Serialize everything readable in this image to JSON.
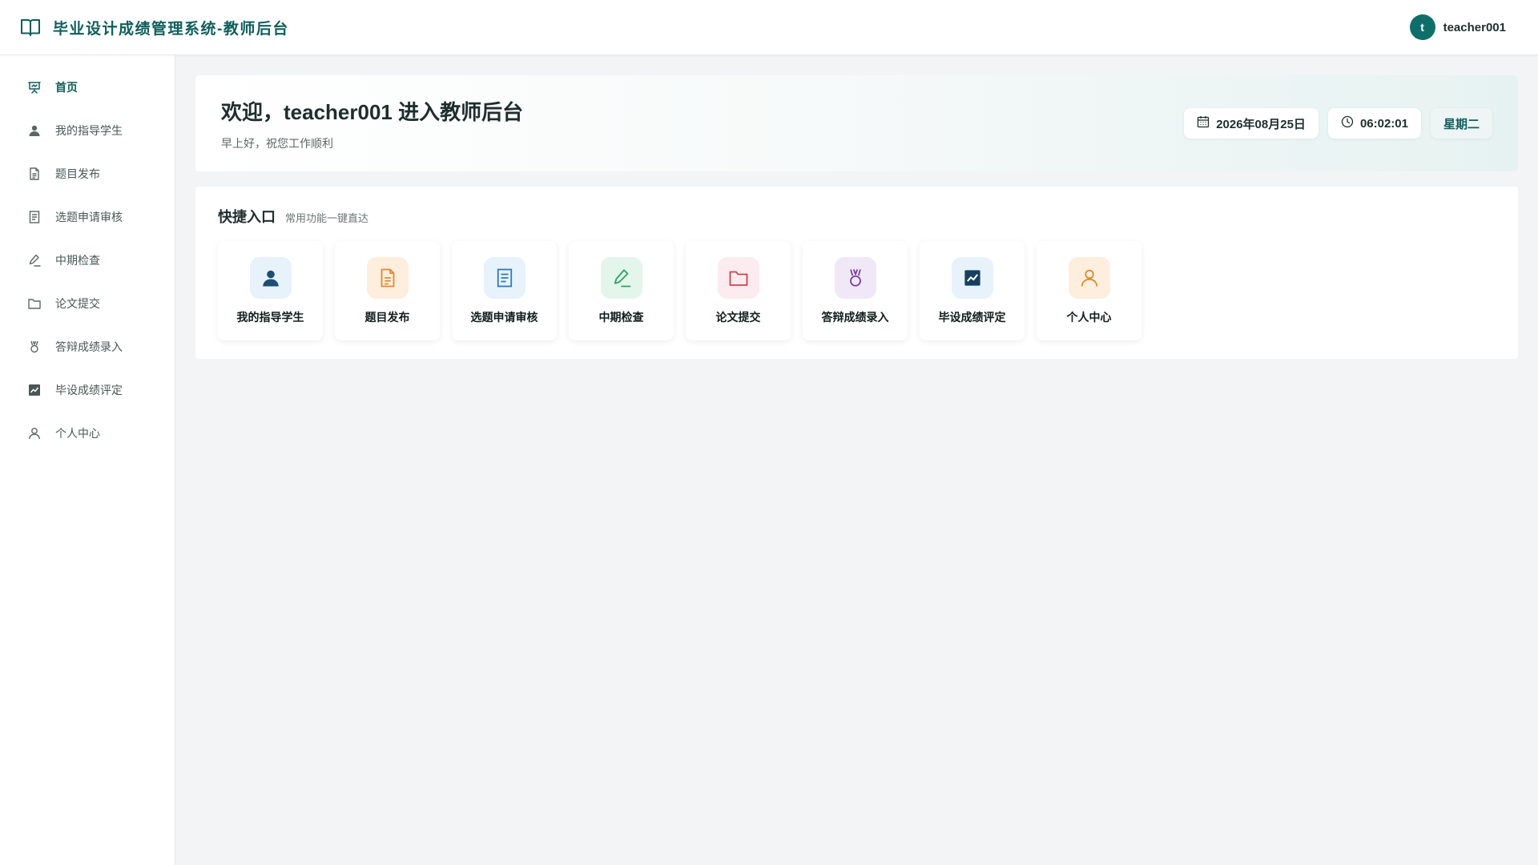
{
  "header": {
    "title": "毕业设计成绩管理系统-教师后台",
    "brand_icon": "book-open-icon",
    "avatar_initial": "t",
    "username": "teacher001"
  },
  "sidebar": {
    "items": [
      {
        "label": "首页",
        "icon": "presentation-icon",
        "active": true
      },
      {
        "label": "我的指导学生",
        "icon": "user-filled-icon"
      },
      {
        "label": "题目发布",
        "icon": "document-icon"
      },
      {
        "label": "选题申请审核",
        "icon": "document-lines-icon"
      },
      {
        "label": "中期检查",
        "icon": "pen-icon"
      },
      {
        "label": "论文提交",
        "icon": "folder-icon"
      },
      {
        "label": "答辩成绩录入",
        "icon": "medal-icon"
      },
      {
        "label": "毕设成绩评定",
        "icon": "chart-icon"
      },
      {
        "label": "个人中心",
        "icon": "user-outline-icon"
      }
    ]
  },
  "welcome": {
    "title": "欢迎，teacher001 进入教师后台",
    "subtitle": "早上好，祝您工作顺利",
    "date": "2026年08月25日",
    "time": "06:02:01",
    "weekday": "星期二"
  },
  "quick": {
    "title": "快捷入口",
    "subtitle": "常用功能一键直达",
    "cards": [
      {
        "label": "我的指导学生",
        "icon": "user-filled-icon",
        "bg": "#e7f2fb",
        "color": "#1c4f72"
      },
      {
        "label": "题目发布",
        "icon": "document-icon",
        "bg": "#fdeedd",
        "color": "#e08a2e"
      },
      {
        "label": "选题申请审核",
        "icon": "document-lines-icon",
        "bg": "#e7f2fb",
        "color": "#2f79b8"
      },
      {
        "label": "中期检查",
        "icon": "pen-icon",
        "bg": "#e4f6ec",
        "color": "#2aa562"
      },
      {
        "label": "论文提交",
        "icon": "folder-icon",
        "bg": "#fdecef",
        "color": "#c9444a"
      },
      {
        "label": "答辩成绩录入",
        "icon": "medal-icon",
        "bg": "#f1e8f7",
        "color": "#7a3fa3"
      },
      {
        "label": "毕设成绩评定",
        "icon": "chart-icon",
        "bg": "#e7f2fb",
        "color": "#163f5f"
      },
      {
        "label": "个人中心",
        "icon": "user-outline-icon",
        "bg": "#fdeedd",
        "color": "#e08a2e"
      }
    ]
  },
  "colors": {
    "primary": "#0f5e5c",
    "avatar": "#0f6e6a",
    "background": "#f3f4f5"
  }
}
